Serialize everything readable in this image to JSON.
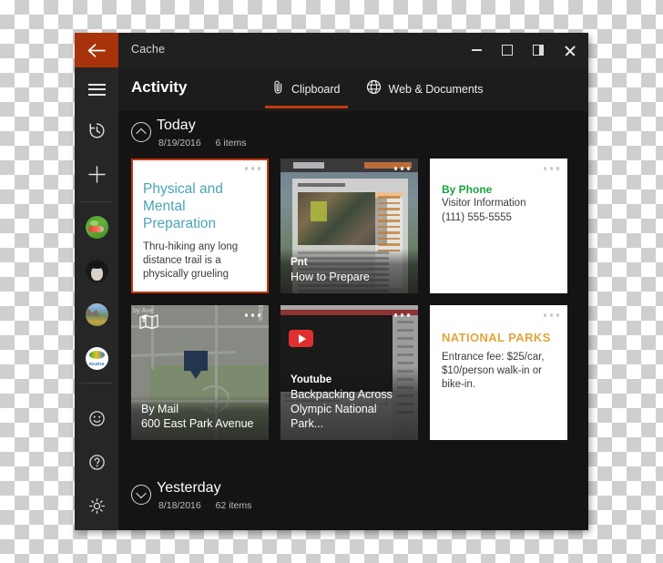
{
  "window": {
    "title": "Cache",
    "back_icon": "back-arrow-icon",
    "controls": {
      "minimize": "minimize-icon",
      "maximize": "maximize-icon",
      "dock": "dock-right-icon",
      "close": "close-icon"
    }
  },
  "sidebar": {
    "menu_icon": "hamburger-menu-icon",
    "items": [
      {
        "icon": "history-clock-icon",
        "name": "history"
      },
      {
        "icon": "plus-icon",
        "name": "add"
      }
    ],
    "avatars": [
      {
        "name": "avatar-green-illustration"
      },
      {
        "name": "avatar-portrait-bw"
      },
      {
        "name": "avatar-landscape-photo"
      },
      {
        "name": "avatar-rio2016",
        "label": "Rio2016"
      }
    ],
    "bottom": [
      {
        "icon": "smiley-face-icon",
        "name": "feedback"
      },
      {
        "icon": "question-mark-icon",
        "name": "help"
      },
      {
        "icon": "gear-icon",
        "name": "settings"
      }
    ]
  },
  "header": {
    "title": "Activity",
    "tabs": [
      {
        "label": "Clipboard",
        "icon": "paperclip-icon",
        "active": true
      },
      {
        "label": "Web & Documents",
        "icon": "globe-icon",
        "active": false
      }
    ]
  },
  "groups": {
    "today": {
      "name": "Today",
      "date": "8/19/2016",
      "count": "6 items",
      "chevron": "chevron-up-icon"
    },
    "yesterday": {
      "name": "Yesterday",
      "date": "8/18/2016",
      "count": "62 items",
      "chevron": "chevron-down-icon"
    }
  },
  "cards": {
    "c1": {
      "title": "Physical and Mental Preparation",
      "body": "Thru-hiking any long distance trail is a physically grueling",
      "title_color": "#4aa3b5",
      "selected": true
    },
    "c2": {
      "source": "Pnt",
      "title": "How to Prepare",
      "page_heading": "How to Prepare"
    },
    "c3": {
      "title": "By Phone",
      "line1": "Visitor Information",
      "line2": "(111) 555-5555",
      "title_color": "#1aa33f"
    },
    "c4": {
      "source": "By Mail",
      "title": "600 East Park Avenue",
      "map_label_1": "by Ave",
      "map_label_2": "S Ebnic",
      "map_icon": "map-icon",
      "pin_icon": "map-pin-icon"
    },
    "c5": {
      "source": "Youtube",
      "title": "Backpacking Across Olympic National Park...",
      "play_icon": "youtube-play-icon"
    },
    "c6": {
      "title": "NATIONAL PARKS",
      "body": "Entrance fee: $25/car, $10/person walk-in or bike-in.",
      "title_color": "#e0a53c"
    }
  },
  "colors": {
    "accent": "#c0380f",
    "back_button": "#a8320a",
    "window_bg": "#1c1c1c",
    "content_bg": "#141414",
    "sidebar_bg": "#262626"
  }
}
